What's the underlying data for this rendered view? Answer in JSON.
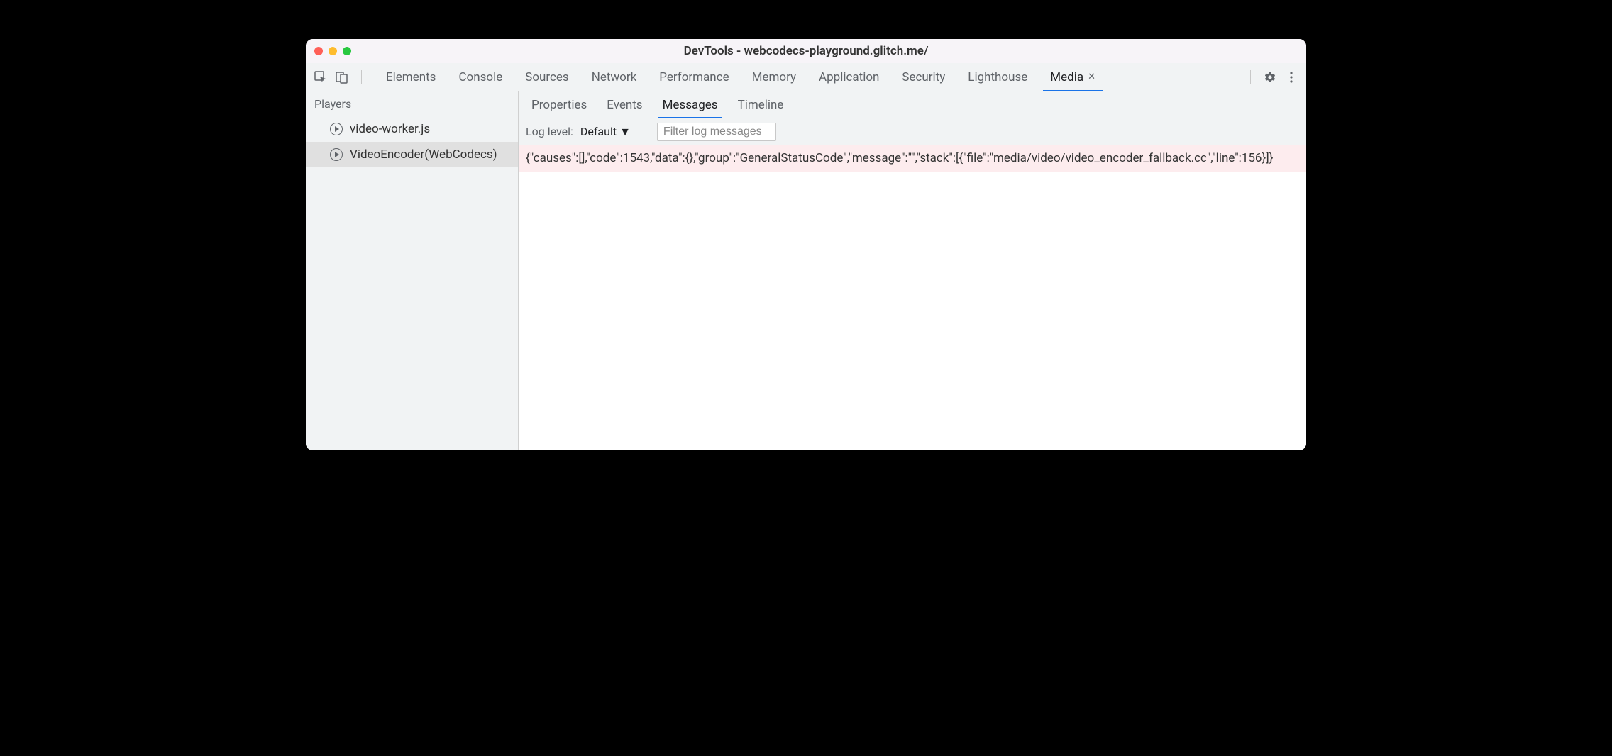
{
  "window": {
    "title": "DevTools - webcodecs-playground.glitch.me/"
  },
  "tabbar": {
    "tabs": [
      {
        "label": "Elements",
        "active": false,
        "closable": false
      },
      {
        "label": "Console",
        "active": false,
        "closable": false
      },
      {
        "label": "Sources",
        "active": false,
        "closable": false
      },
      {
        "label": "Network",
        "active": false,
        "closable": false
      },
      {
        "label": "Performance",
        "active": false,
        "closable": false
      },
      {
        "label": "Memory",
        "active": false,
        "closable": false
      },
      {
        "label": "Application",
        "active": false,
        "closable": false
      },
      {
        "label": "Security",
        "active": false,
        "closable": false
      },
      {
        "label": "Lighthouse",
        "active": false,
        "closable": false
      },
      {
        "label": "Media",
        "active": true,
        "closable": true
      }
    ]
  },
  "sidebar": {
    "header": "Players",
    "players": [
      {
        "label": "video-worker.js",
        "selected": false
      },
      {
        "label": "VideoEncoder(WebCodecs)",
        "selected": true
      }
    ]
  },
  "subtabs": [
    {
      "label": "Properties",
      "active": false
    },
    {
      "label": "Events",
      "active": false
    },
    {
      "label": "Messages",
      "active": true
    },
    {
      "label": "Timeline",
      "active": false
    }
  ],
  "filterbar": {
    "label": "Log level:",
    "select_value": "Default",
    "filter_placeholder": "Filter log messages"
  },
  "log": {
    "rows": [
      "{\"causes\":[],\"code\":1543,\"data\":{},\"group\":\"GeneralStatusCode\",\"message\":\"\",\"stack\":[{\"file\":\"media/video/video_encoder_fallback.cc\",\"line\":156}]}"
    ]
  }
}
